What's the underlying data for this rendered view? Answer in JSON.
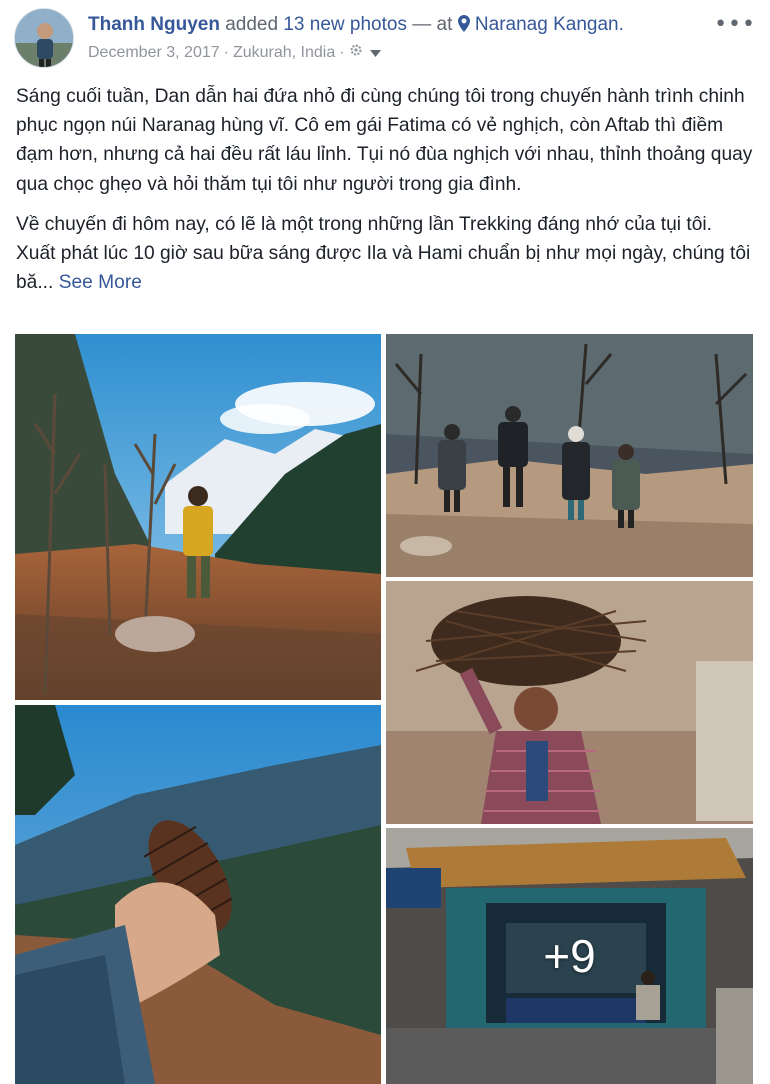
{
  "post": {
    "author": "Thanh Nguyen",
    "added_text": "added",
    "photo_count_text": "13 new photos",
    "at_text": "— at",
    "location": "Naranag Kangan.",
    "date": "December 3, 2017",
    "place": "Zukurah, India",
    "menu_icon": "ellipsis-icon",
    "privacy_icon": "gear-icon",
    "dropdown_icon": "caret-down-icon",
    "location_icon": "map-pin-icon",
    "paragraph_1": "Sáng cuối tuần, Dan dẫn hai đứa nhỏ đi cùng chúng tôi trong chuyến hành trình chinh phục ngọn núi Naranag hùng vĩ. Cô em gái Fatima có vẻ nghịch, còn Aftab thì điềm đạm hơn, nhưng cả hai đều rất láu lỉnh. Tụi nó đùa nghịch với nhau, thỉnh thoảng quay qua chọc ghẹo và hỏi thăm tụi tôi như người trong gia đình.",
    "paragraph_2": "Về chuyến đi hôm nay, có lẽ là một trong những lần Trekking đáng nhớ của tụi tôi. Xuất phát lúc 10 giờ sau bữa sáng được Ila và Hami chuẩn bị như mọi ngày, chúng tôi bă...",
    "see_more": "See More"
  },
  "photos": {
    "more_overlay": "+9"
  },
  "colors": {
    "link": "#365899",
    "meta": "#90949c",
    "text": "#1d2129"
  }
}
